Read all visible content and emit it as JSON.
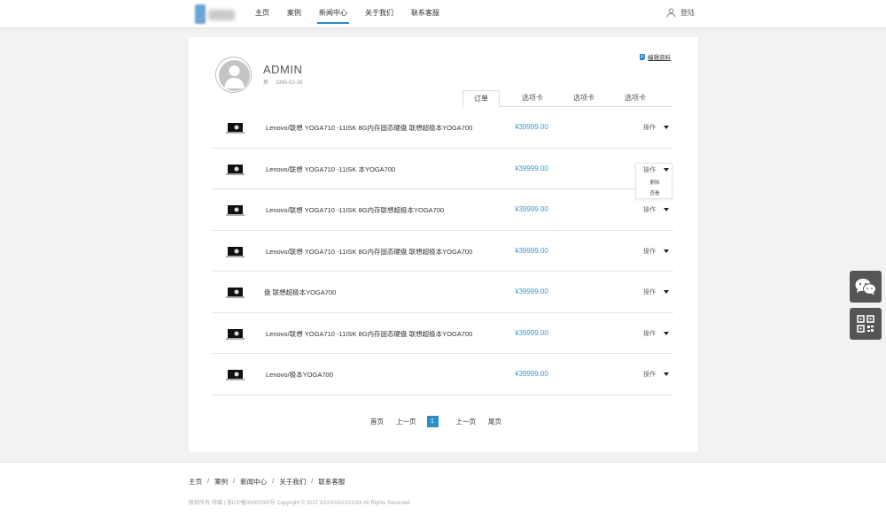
{
  "header": {
    "nav": [
      {
        "label": "主页"
      },
      {
        "label": "案例"
      },
      {
        "label": "新闻中心",
        "active": true
      },
      {
        "label": "关于我们"
      },
      {
        "label": "联系客服"
      }
    ],
    "login_label": "登陆"
  },
  "profile": {
    "name": "ADMIN",
    "gender": "男",
    "birthday": "1965-02-28",
    "edit_label": "编辑资料"
  },
  "tabs": [
    {
      "label": "订单",
      "active": true
    },
    {
      "label": "选项卡"
    },
    {
      "label": "选项卡"
    },
    {
      "label": "选项卡"
    }
  ],
  "orders": [
    {
      "name": "Lenovo/联想 YOGA710 -11ISK 8G内存固态硬盘 联想超极本YOGA700",
      "price": "¥39999.00",
      "action": "操作"
    },
    {
      "name": "Lenovo/联想 YOGA710 -11ISK 本YOGA700",
      "price": "¥39999.00",
      "action": "操作"
    },
    {
      "name": "Lenovo/联想 YOGA710 -11ISK 8G内存联想超极本YOGA700",
      "price": "¥39999.00",
      "action": "操作"
    },
    {
      "name": "Lenovo/联想 YOGA710 -11ISK 8G内存固态硬盘 联想超极本YOGA700",
      "price": "¥39999.00",
      "action": "操作"
    },
    {
      "name": "盘 联想超极本YOGA700",
      "price": "¥39999.00",
      "action": "操作"
    },
    {
      "name": "Lenovo/联想 YOGA710 -11ISK 8G内存固态硬盘 联想超极本YOGA700",
      "price": "¥39999.00",
      "action": "操作"
    },
    {
      "name": "Lenovo/极本YOGA700",
      "price": "¥39999.00",
      "action": "操作"
    }
  ],
  "dropdown": {
    "items": [
      "删除",
      "查看"
    ]
  },
  "pager": {
    "first": "首页",
    "prev": "上一页",
    "current": "1",
    "next": "上一页",
    "last": "尾页"
  },
  "footer": {
    "links": [
      "主页",
      "案例",
      "新闻中心",
      "关于我们",
      "联系客服"
    ],
    "separator": "/",
    "copyright": "版权所有-侍媒 | 浙ICP备00000000号 Copyright © 2017 XXXXXXXXXXXX All Rights Reserved"
  },
  "colors": {
    "accent": "#2a8fc7",
    "price": "#3a9bd2",
    "float_button": "#555555"
  },
  "icons": {
    "login": "user-icon",
    "edit": "edit-icon",
    "float_top": "wechat-icon",
    "float_bottom": "qrcode-icon"
  }
}
